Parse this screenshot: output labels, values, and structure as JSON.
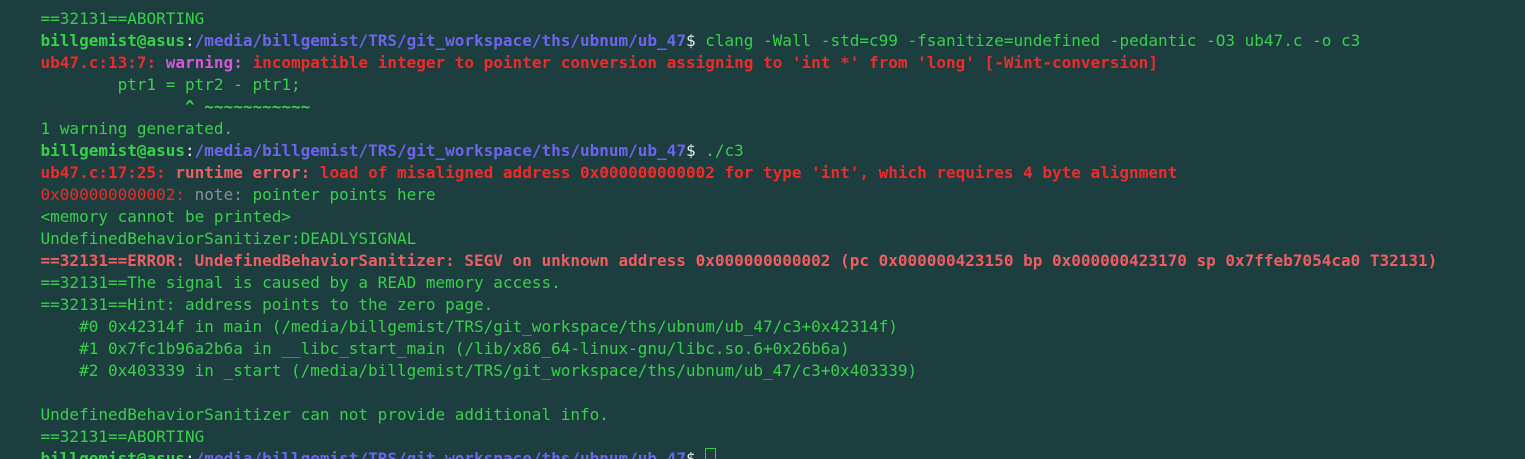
{
  "terminal": {
    "prompt_user": "billgemist@asus",
    "prompt_path": "/media/billgemist/TRS/git_workspace/ths/ubnum/ub_47",
    "prompt_symbol": "$",
    "line0": "==32131==ABORTING",
    "cmd1": " clang -Wall -std=c99 -fsanitize=undefined -pedantic -O3 ub47.c -o c3",
    "warn_loc": "ub47.c:13:7:",
    "warn_label": " warning:",
    "warn_msg": " incompatible integer to pointer conversion assigning to 'int *' from 'long' [-Wint-conversion]",
    "code_line": "        ptr1 = ptr2 - ptr1;",
    "caret_line": "               ^ ~~~~~~~~~~~",
    "warn_count": "1 warning generated.",
    "cmd2": " ./c3",
    "rt_loc": "ub47.c:17:25:",
    "rt_label": " runtime error:",
    "rt_msg": " load of misaligned address 0x000000000002 for type 'int', which requires 4 byte alignment",
    "note_addr": "0x000000000002:",
    "note_label": " note:",
    "note_msg": " pointer points here",
    "mem_line": "<memory cannot be printed>",
    "deadly": "UndefinedBehaviorSanitizer:DEADLYSIGNAL",
    "err_line": "==32131==ERROR: UndefinedBehaviorSanitizer: SEGV on unknown address 0x000000000002 (pc 0x000000423150 bp 0x000000423170 sp 0x7ffeb7054ca0 T32131)",
    "signal_line": "==32131==The signal is caused by a READ memory access.",
    "hint_line": "==32131==Hint: address points to the zero page.",
    "frame0": "    #0 0x42314f in main (/media/billgemist/TRS/git_workspace/ths/ubnum/ub_47/c3+0x42314f)",
    "frame1": "    #1 0x7fc1b96a2b6a in __libc_start_main (/lib/x86_64-linux-gnu/libc.so.6+0x26b6a)",
    "frame2": "    #2 0x403339 in _start (/media/billgemist/TRS/git_workspace/ths/ubnum/ub_47/c3+0x403339)",
    "no_info": "UndefinedBehaviorSanitizer can not provide additional info.",
    "aborting": "==32131==ABORTING"
  },
  "colors": {
    "background": "#1d3e3f",
    "green": "#35d14a",
    "blue_path": "#6f63ee",
    "red": "#ef2a2a",
    "salmon": "#ee5d62",
    "magenta": "#d655d8"
  }
}
